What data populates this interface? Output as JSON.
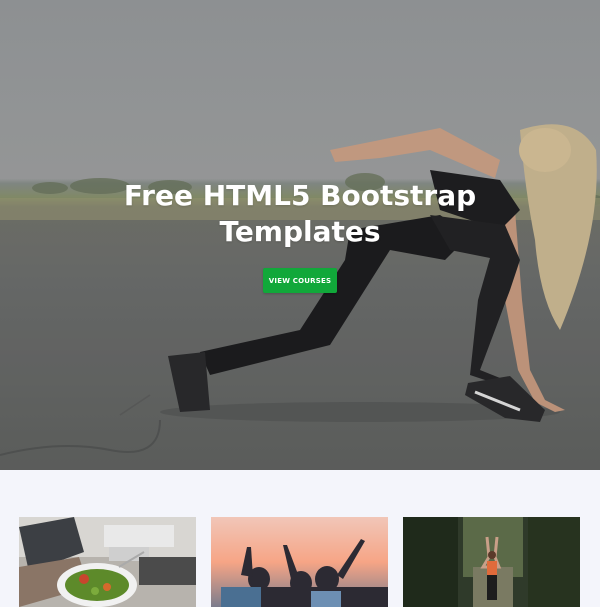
{
  "hero": {
    "title_line1": "Free HTML5 Bootstrap",
    "title_line2": "Templates",
    "cta_label": "VIEW COURSES",
    "accent_color": "#11a83a"
  },
  "courses": {
    "cards": [
      {
        "image": "salad-laptop-photo"
      },
      {
        "image": "friends-sunset-photo"
      },
      {
        "image": "yoga-forest-photo"
      }
    ]
  }
}
